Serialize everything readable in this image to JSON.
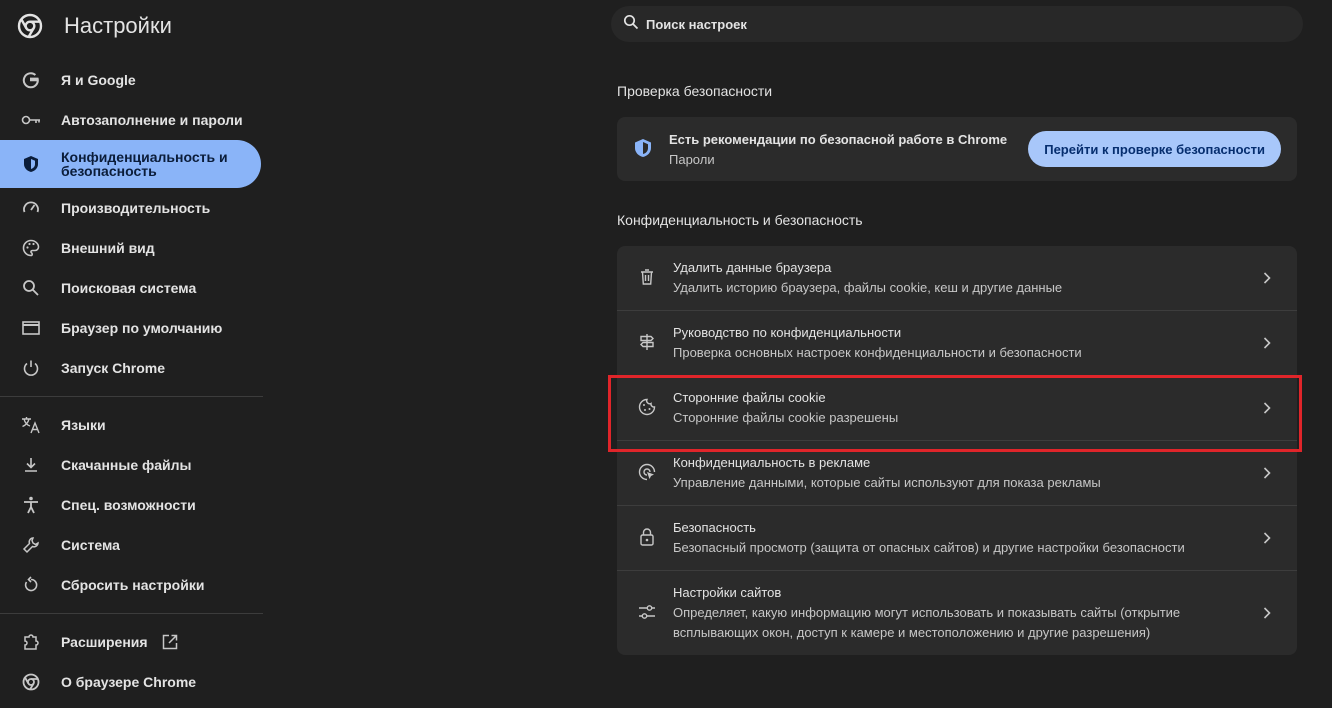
{
  "app": {
    "title": "Настройки"
  },
  "search": {
    "placeholder": "Поиск настроек"
  },
  "sidebar": {
    "items": [
      {
        "label": "Я и Google",
        "icon": "google-g-icon"
      },
      {
        "label": "Автозаполнение и пароли",
        "icon": "key-icon"
      },
      {
        "label": "Конфиденциальность и безопасность",
        "icon": "shield-icon",
        "active": true
      },
      {
        "label": "Производительность",
        "icon": "speedometer-icon"
      },
      {
        "label": "Внешний вид",
        "icon": "palette-icon"
      },
      {
        "label": "Поисковая система",
        "icon": "search-icon"
      },
      {
        "label": "Браузер по умолчанию",
        "icon": "browser-window-icon"
      },
      {
        "label": "Запуск Chrome",
        "icon": "power-icon"
      },
      {
        "label": "Языки",
        "icon": "translate-icon"
      },
      {
        "label": "Скачанные файлы",
        "icon": "download-icon"
      },
      {
        "label": "Спец. возможности",
        "icon": "accessibility-icon"
      },
      {
        "label": "Система",
        "icon": "wrench-icon"
      },
      {
        "label": "Сбросить настройки",
        "icon": "reset-icon"
      },
      {
        "label": "Расширения",
        "icon": "puzzle-icon"
      },
      {
        "label": "О браузере Chrome",
        "icon": "chrome-icon"
      }
    ]
  },
  "safety_check": {
    "section_title": "Проверка безопасности",
    "title": "Есть рекомендации по безопасной работе в Chrome",
    "subtitle": "Пароли",
    "button": "Перейти к проверке безопасности"
  },
  "privacy": {
    "section_title": "Конфиденциальность и безопасность",
    "rows": [
      {
        "title": "Удалить данные браузера",
        "subtitle": "Удалить историю браузера, файлы cookie, кеш и другие данные",
        "icon": "trash-icon"
      },
      {
        "title": "Руководство по конфиденциальности",
        "subtitle": "Проверка основных настроек конфиденциальности и безопасности",
        "icon": "signpost-icon"
      },
      {
        "title": "Сторонние файлы cookie",
        "subtitle": "Сторонние файлы cookie разрешены",
        "icon": "cookie-icon"
      },
      {
        "title": "Конфиденциальность в рекламе",
        "subtitle": "Управление данными, которые сайты используют для показа рекламы",
        "icon": "ad-privacy-icon"
      },
      {
        "title": "Безопасность",
        "subtitle": "Безопасный просмотр (защита от опасных сайтов) и другие настройки безопасности",
        "icon": "lock-icon"
      },
      {
        "title": "Настройки сайтов",
        "subtitle": "Определяет, какую информацию могут использовать и показывать сайты (открытие всплывающих окон, доступ к камере и местоположению и другие разрешения)",
        "icon": "site-settings-icon"
      }
    ]
  },
  "colors": {
    "accent": "#8ab4f8",
    "highlight": "#e0252a",
    "background": "#1f1f1f",
    "card": "#2b2b2b"
  }
}
